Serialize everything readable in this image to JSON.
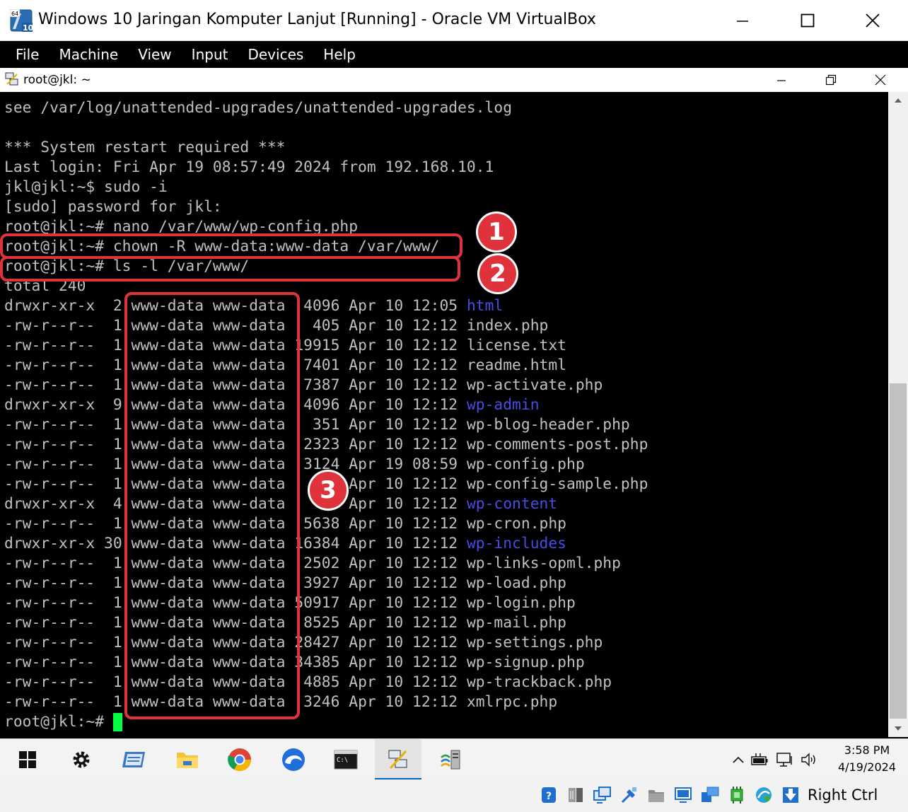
{
  "vbox": {
    "window_title": "Windows 10 Jaringan Komputer Lanjut [Running] - Oracle VM VirtualBox",
    "icon_badge_top": "64",
    "icon_badge_bottom": "10",
    "menu": [
      "File",
      "Machine",
      "View",
      "Input",
      "Devices",
      "Help"
    ],
    "host_key_label": "Right Ctrl"
  },
  "putty": {
    "title": "root@jkl: ~"
  },
  "terminal": {
    "lines": [
      "see /var/log/unattended-upgrades/unattended-upgrades.log",
      "",
      "*** System restart required ***",
      "Last login: Fri Apr 19 08:57:49 2024 from 192.168.10.1",
      "jkl@jkl:~$ sudo -i",
      "[sudo] password for jkl:",
      "root@jkl:~# nano /var/www/wp-config.php",
      "root@jkl:~# chown -R www-data:www-data /var/www/",
      "root@jkl:~# ls -l /var/www/",
      "total 240"
    ],
    "listing": [
      {
        "perms": "drwxr-xr-x",
        "links": "2",
        "owner": "www-data",
        "group": "www-data",
        "size": "4096",
        "date": "Apr 10 12:05",
        "name": "html",
        "is_dir": true
      },
      {
        "perms": "-rw-r--r--",
        "links": "1",
        "owner": "www-data",
        "group": "www-data",
        "size": "405",
        "date": "Apr 10 12:12",
        "name": "index.php",
        "is_dir": false
      },
      {
        "perms": "-rw-r--r--",
        "links": "1",
        "owner": "www-data",
        "group": "www-data",
        "size": "19915",
        "date": "Apr 10 12:12",
        "name": "license.txt",
        "is_dir": false
      },
      {
        "perms": "-rw-r--r--",
        "links": "1",
        "owner": "www-data",
        "group": "www-data",
        "size": "7401",
        "date": "Apr 10 12:12",
        "name": "readme.html",
        "is_dir": false
      },
      {
        "perms": "-rw-r--r--",
        "links": "1",
        "owner": "www-data",
        "group": "www-data",
        "size": "7387",
        "date": "Apr 10 12:12",
        "name": "wp-activate.php",
        "is_dir": false
      },
      {
        "perms": "drwxr-xr-x",
        "links": "9",
        "owner": "www-data",
        "group": "www-data",
        "size": "4096",
        "date": "Apr 10 12:12",
        "name": "wp-admin",
        "is_dir": true
      },
      {
        "perms": "-rw-r--r--",
        "links": "1",
        "owner": "www-data",
        "group": "www-data",
        "size": "351",
        "date": "Apr 10 12:12",
        "name": "wp-blog-header.php",
        "is_dir": false
      },
      {
        "perms": "-rw-r--r--",
        "links": "1",
        "owner": "www-data",
        "group": "www-data",
        "size": "2323",
        "date": "Apr 10 12:12",
        "name": "wp-comments-post.php",
        "is_dir": false
      },
      {
        "perms": "-rw-r--r--",
        "links": "1",
        "owner": "www-data",
        "group": "www-data",
        "size": "3124",
        "date": "Apr 19 08:59",
        "name": "wp-config.php",
        "is_dir": false
      },
      {
        "perms": "-rw-r--r--",
        "links": "1",
        "owner": "www-data",
        "group": "www-data",
        "size": "3",
        "date": "Apr 10 12:12",
        "name": "wp-config-sample.php",
        "is_dir": false
      },
      {
        "perms": "drwxr-xr-x",
        "links": "4",
        "owner": "www-data",
        "group": "www-data",
        "size": "4",
        "date": "Apr 10 12:12",
        "name": "wp-content",
        "is_dir": true
      },
      {
        "perms": "-rw-r--r--",
        "links": "1",
        "owner": "www-data",
        "group": "www-data",
        "size": "5638",
        "date": "Apr 10 12:12",
        "name": "wp-cron.php",
        "is_dir": false
      },
      {
        "perms": "drwxr-xr-x",
        "links": "30",
        "owner": "www-data",
        "group": "www-data",
        "size": "16384",
        "date": "Apr 10 12:12",
        "name": "wp-includes",
        "is_dir": true
      },
      {
        "perms": "-rw-r--r--",
        "links": "1",
        "owner": "www-data",
        "group": "www-data",
        "size": "2502",
        "date": "Apr 10 12:12",
        "name": "wp-links-opml.php",
        "is_dir": false
      },
      {
        "perms": "-rw-r--r--",
        "links": "1",
        "owner": "www-data",
        "group": "www-data",
        "size": "3927",
        "date": "Apr 10 12:12",
        "name": "wp-load.php",
        "is_dir": false
      },
      {
        "perms": "-rw-r--r--",
        "links": "1",
        "owner": "www-data",
        "group": "www-data",
        "size": "50917",
        "date": "Apr 10 12:12",
        "name": "wp-login.php",
        "is_dir": false
      },
      {
        "perms": "-rw-r--r--",
        "links": "1",
        "owner": "www-data",
        "group": "www-data",
        "size": "8525",
        "date": "Apr 10 12:12",
        "name": "wp-mail.php",
        "is_dir": false
      },
      {
        "perms": "-rw-r--r--",
        "links": "1",
        "owner": "www-data",
        "group": "www-data",
        "size": "28427",
        "date": "Apr 10 12:12",
        "name": "wp-settings.php",
        "is_dir": false
      },
      {
        "perms": "-rw-r--r--",
        "links": "1",
        "owner": "www-data",
        "group": "www-data",
        "size": "34385",
        "date": "Apr 10 12:12",
        "name": "wp-signup.php",
        "is_dir": false
      },
      {
        "perms": "-rw-r--r--",
        "links": "1",
        "owner": "www-data",
        "group": "www-data",
        "size": "4885",
        "date": "Apr 10 12:12",
        "name": "wp-trackback.php",
        "is_dir": false
      },
      {
        "perms": "-rw-r--r--",
        "links": "1",
        "owner": "www-data",
        "group": "www-data",
        "size": "3246",
        "date": "Apr 10 12:12",
        "name": "xmlrpc.php",
        "is_dir": false
      }
    ],
    "prompt": "root@jkl:~# ",
    "dir_color": "#4a4ae6",
    "cursor_color": "#00ff40"
  },
  "annotations": {
    "badges": [
      "1",
      "2",
      "3"
    ],
    "color": "#e0323b"
  },
  "taskbar": {
    "apps": [
      "start-icon",
      "settings-icon",
      "mail-icon",
      "file-explorer-icon",
      "chrome-icon",
      "edge-icon",
      "command-prompt-icon",
      "putty-icon",
      "network-tool-icon"
    ],
    "time": "3:58 PM",
    "date": "4/19/2024"
  }
}
